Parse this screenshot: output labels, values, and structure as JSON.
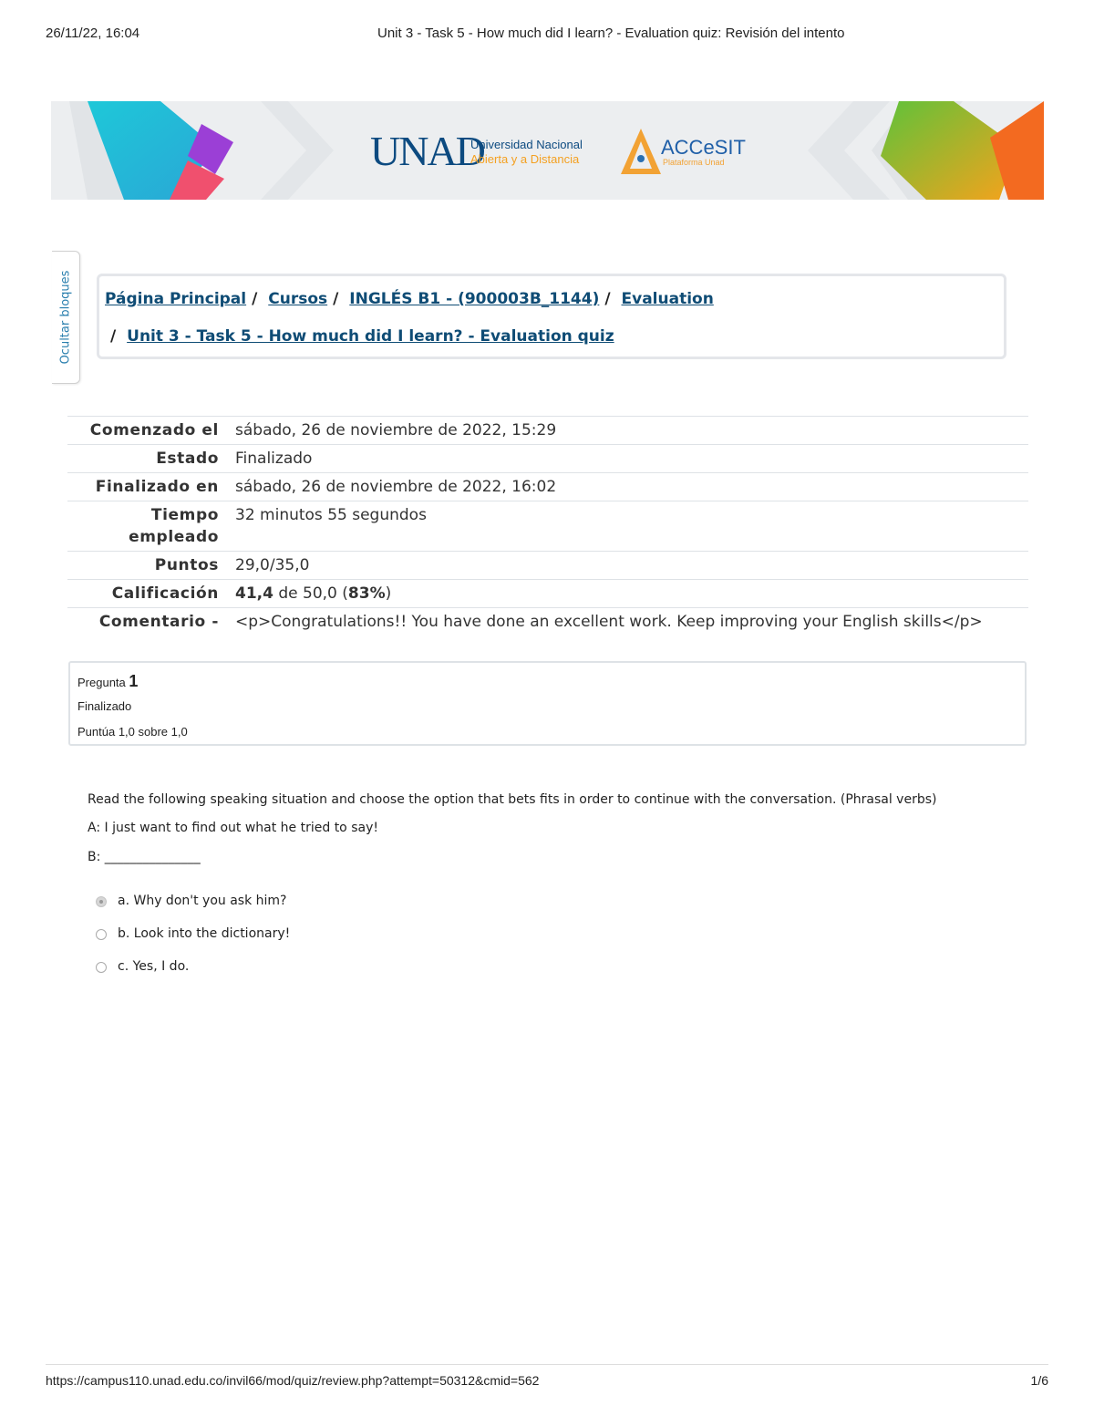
{
  "print_header": {
    "date": "26/11/22, 16:04",
    "title": "Unit 3 - Task 5 - How much did I learn? - Evaluation quiz: Revisión del intento"
  },
  "banner": {
    "unad_logo_text": "UNAD",
    "university_line1": "Universidad Nacional",
    "university_line2": "Abierta y a Distancia",
    "accesit_logo_text": "ACCeSIT",
    "accesit_sub": "Plataforma Unad"
  },
  "hide_blocks": {
    "label": "Ocultar bloques"
  },
  "breadcrumb": {
    "items": [
      "Página Principal",
      "Cursos",
      "INGLÉS B1 - (900003B_1144)",
      "Evaluation",
      "Unit 3 - Task 5 - How much did I learn? - Evaluation quiz"
    ],
    "separator": "/"
  },
  "summary": {
    "rows": [
      {
        "label": "Comenzado el",
        "value": "sábado, 26 de noviembre de 2022, 15:29"
      },
      {
        "label": "Estado",
        "value": "Finalizado"
      },
      {
        "label": "Finalizado en",
        "value": "sábado, 26 de noviembre de 2022, 16:02"
      },
      {
        "label": "Tiempo empleado",
        "value": "32 minutos 55 segundos"
      },
      {
        "label": "Puntos",
        "value": "29,0/35,0"
      }
    ],
    "grade": {
      "label": "Calificación",
      "score": "41,4",
      "out_of": " de 50,0 (",
      "percent": "83%",
      "close": ")"
    },
    "comment": {
      "label": "Comentario -",
      "value": "<p>Congratulations!! You have done an excellent work. Keep improving your English skills</p>"
    }
  },
  "question": {
    "label": "Pregunta",
    "number": "1",
    "state": "Finalizado",
    "grade": "Puntúa 1,0 sobre 1,0",
    "text_line1": "Read the following speaking situation and choose the option that bets fits in order to continue with the conversation. (Phrasal verbs)",
    "text_line2": "A: I just want to find out what he tried to say!",
    "text_line3": "B: _______________",
    "options": [
      {
        "label": "a. Why don't you ask him?",
        "selected": true
      },
      {
        "label": "b. Look into the dictionary!",
        "selected": false
      },
      {
        "label": "c. Yes, I do.",
        "selected": false
      }
    ]
  },
  "print_footer": {
    "url": "https://campus110.unad.edu.co/invil66/mod/quiz/review.php?attempt=50312&cmid=562",
    "page": "1/6"
  }
}
